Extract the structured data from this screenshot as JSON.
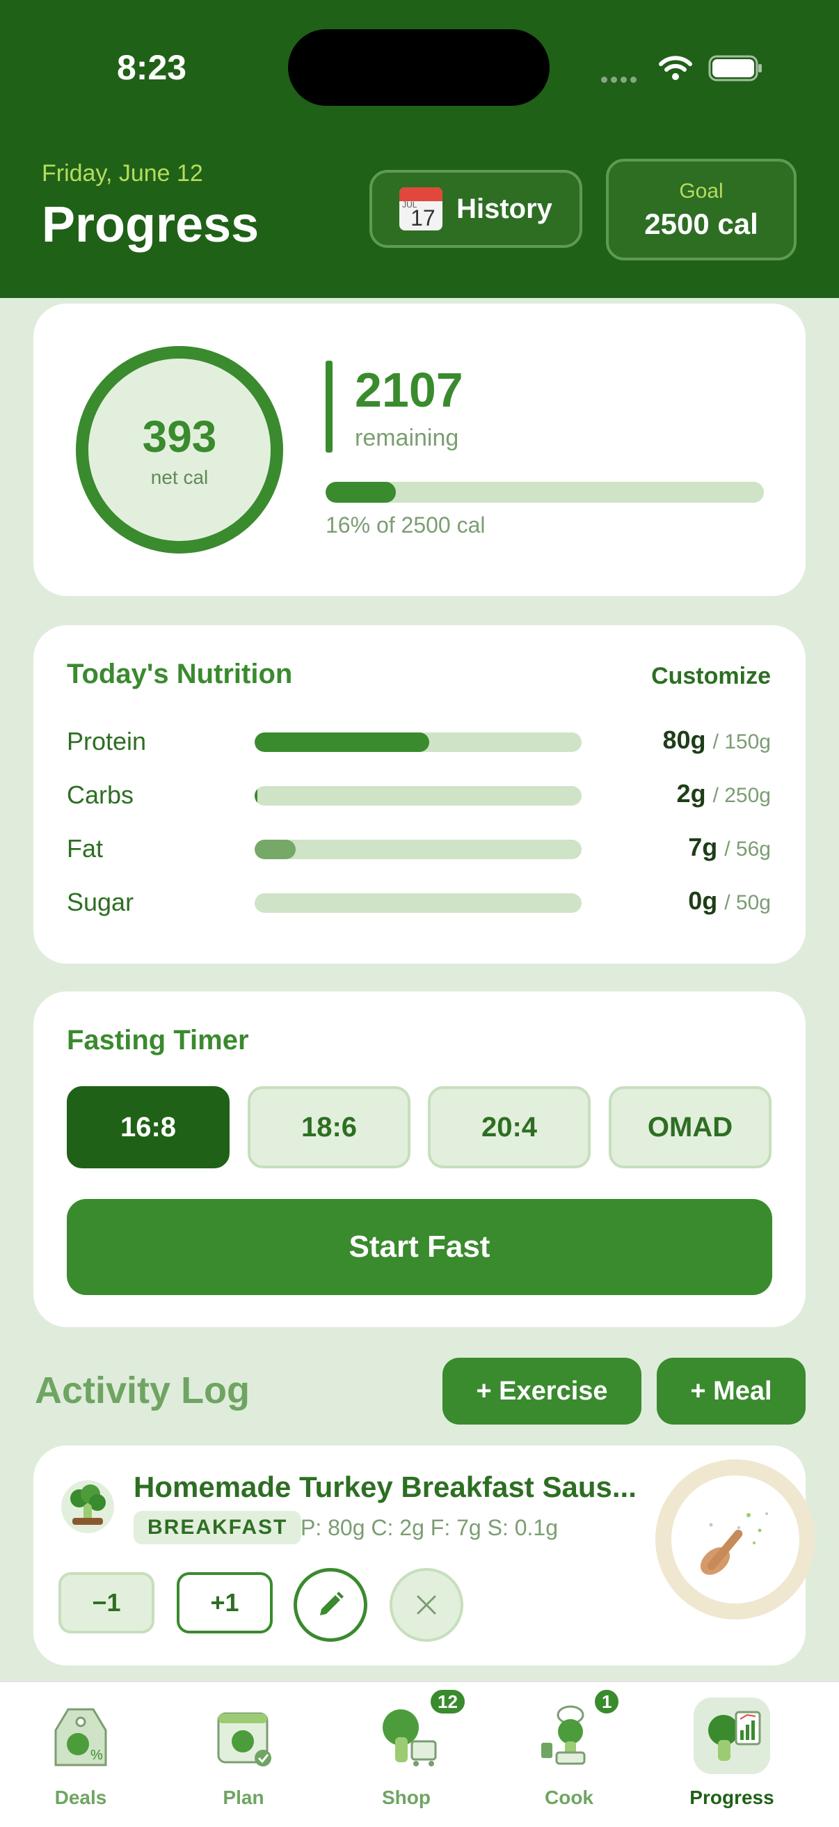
{
  "status": {
    "time": "8:23"
  },
  "header": {
    "date": "Friday, June 12",
    "title": "Progress",
    "history_label": "History",
    "calendar_month": "JUL",
    "calendar_day": "17",
    "goal_label": "Goal",
    "goal_value": "2500 cal"
  },
  "summary": {
    "net_cal": "393",
    "net_cal_label": "net cal",
    "remaining": "2107",
    "remaining_label": "remaining",
    "percent": 16,
    "percent_label": "16% of 2500 cal"
  },
  "nutrition": {
    "title": "Today's Nutrition",
    "customize_label": "Customize",
    "rows": [
      {
        "name": "Protein",
        "value": "80g",
        "goal": "/ 150g",
        "fraction": 0.533
      },
      {
        "name": "Carbs",
        "value": "2g",
        "goal": "/ 250g",
        "fraction": 0.008
      },
      {
        "name": "Fat",
        "value": "7g",
        "goal": "/ 56g",
        "fraction": 0.125
      },
      {
        "name": "Sugar",
        "value": "0g",
        "goal": "/ 50g",
        "fraction": 0
      }
    ]
  },
  "fasting": {
    "title": "Fasting Timer",
    "options": [
      "16:8",
      "18:6",
      "20:4",
      "OMAD"
    ],
    "selected": "16:8",
    "start_label": "Start Fast"
  },
  "activity": {
    "title": "Activity Log",
    "exercise_label": "+ Exercise",
    "meal_label": "+ Meal",
    "entry": {
      "name": "Homemade Turkey Breakfast Saus...",
      "badge": "BREAKFAST",
      "macros": "P: 80g  C: 2g  F: 7g  S: 0.1g",
      "minus_label": "−1",
      "plus_label": "+1"
    }
  },
  "tabs": [
    {
      "label": "Deals",
      "badge": ""
    },
    {
      "label": "Plan",
      "badge": ""
    },
    {
      "label": "Shop",
      "badge": "12"
    },
    {
      "label": "Cook",
      "badge": "1"
    },
    {
      "label": "Progress",
      "badge": ""
    }
  ],
  "colors": {
    "primary": "#3a8a2e",
    "dark": "#1f6117",
    "track": "#cfe3c6",
    "bg": "#dfecdb"
  }
}
